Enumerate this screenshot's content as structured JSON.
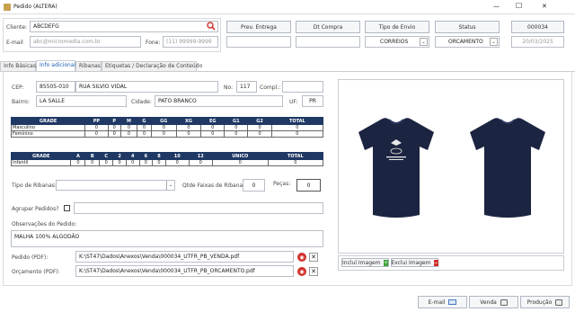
{
  "window": {
    "title": "Pedido (ALTERA)",
    "minimize": "—",
    "maximize": "☐",
    "close": "✕"
  },
  "client": {
    "label": "Cliente:",
    "value": "ABCDEFG",
    "email_label": "E-mail",
    "email_value": "abc@micromedia.com.br",
    "phone_label": "Fone:",
    "phone_value": "(11) 99999-9999"
  },
  "header_buttons": {
    "prev_entrega": "Prev. Entrega",
    "dt_compra": "Dt Compra",
    "tipo_envio": "Tipo de Envio",
    "status": "Status",
    "order_number": "000034"
  },
  "header_selects": {
    "tipo_envio_value": "CORREIOS",
    "status_value": "ORCAMENTO",
    "date_value": "20/03/2025"
  },
  "tabs": [
    "Info Básicas",
    "Info adicionais",
    "Ribanas",
    "Etiquetas / Declaração de Conteúdo"
  ],
  "address": {
    "cep_label": "CEP:",
    "cep": "85505-010",
    "street": "RUA SILVIO VIDAL",
    "no_label": "No:",
    "no": "117",
    "compl_label": "Compl.:",
    "compl": "",
    "bairro_label": "Bairro:",
    "bairro": "LA SALLE",
    "cidade_label": "Cidade:",
    "cidade": "PATO BRANCO",
    "uf_label": "UF:",
    "uf": "PR"
  },
  "grid1": {
    "headers": [
      "GRADE",
      "PP",
      "P",
      "M",
      "G",
      "GG",
      "XG",
      "EG",
      "G1",
      "G2",
      "TOTAL"
    ],
    "rows": [
      {
        "name": "Masculino",
        "values": [
          "0",
          "0",
          "0",
          "0",
          "0",
          "0",
          "0",
          "0",
          "0",
          "0"
        ]
      },
      {
        "name": "Feminino",
        "values": [
          "0",
          "0",
          "0",
          "0",
          "0",
          "0",
          "0",
          "0",
          "0",
          "0"
        ]
      }
    ]
  },
  "grid2": {
    "headers": [
      "GRADE",
      "A",
      "B",
      "C",
      "2",
      "4",
      "6",
      "8",
      "10",
      "12",
      "UNICO",
      "TOTAL"
    ],
    "rows": [
      {
        "name": "Infantil",
        "values": [
          "0",
          "0",
          "0",
          "0",
          "0",
          "0",
          "0",
          "0",
          "0",
          "0",
          "0"
        ]
      }
    ]
  },
  "ribanas": {
    "tipo_label": "Tipo de Ribanas:",
    "tipo_value": "",
    "qtde_label": "Qtde Faixas de Ribanas:",
    "qtde_value": "0",
    "pecas_label": "Peças:",
    "pecas_value": "0"
  },
  "agrupar": {
    "label": "Agrupar Pedidos?",
    "value": ""
  },
  "obs": {
    "label": "Observações do Pedido:",
    "value": "MALHA 100% ALGODÃO"
  },
  "files": {
    "pedido_label": "Pedido (PDF):",
    "pedido_path": "K:\\ST47\\Dados\\Anexos\\Venda\\000034_UTFR_PB_VENDA.pdf",
    "orc_label": "Orçamento (PDF):",
    "orc_path": "K:\\ST47\\Dados\\Anexos\\Venda\\000034_UTFR_PB_ORCAMENTO.pdf"
  },
  "image_buttons": {
    "include": "Incluí Imagem",
    "exclude": "Exclui Imagem"
  },
  "footer": {
    "email": "E-mail",
    "venda": "Venda",
    "producao": "Produção"
  },
  "colors": {
    "header_blue": "#1f3864",
    "accent": "#1a5fb4",
    "danger": "#d0312d",
    "green": "#3aa335"
  }
}
